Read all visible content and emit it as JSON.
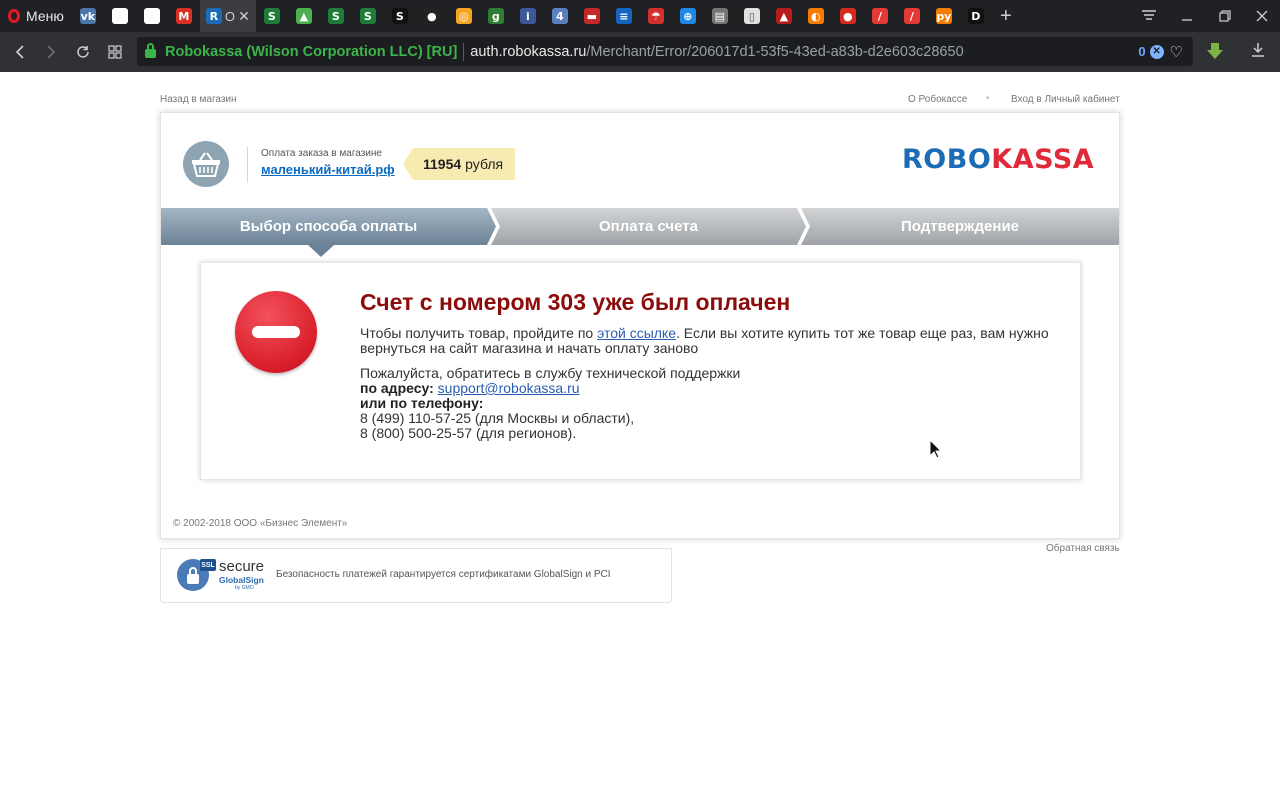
{
  "browser": {
    "menu_label": "Меню",
    "tabs": [
      {
        "icon": "vk-icon",
        "glyph": "vk",
        "bg": "#4a76a8"
      },
      {
        "icon": "blank-page-icon",
        "glyph": "",
        "bg": "#ffffff"
      },
      {
        "icon": "blank-page-icon",
        "glyph": "",
        "bg": "#ffffff"
      },
      {
        "icon": "gmail-icon",
        "glyph": "M",
        "bg": "#d93025"
      },
      {
        "icon": "s-green-icon",
        "glyph": "S",
        "bg": "#1e7b3a"
      },
      {
        "icon": "green-leaf-icon",
        "glyph": "▲",
        "bg": "#4caf50"
      },
      {
        "icon": "s-green-icon",
        "glyph": "S",
        "bg": "#1e7b3a"
      },
      {
        "icon": "s-green-icon",
        "glyph": "S",
        "bg": "#1e7b3a"
      },
      {
        "icon": "s-black-icon",
        "glyph": "S",
        "bg": "#111111"
      },
      {
        "icon": "ball-icon",
        "glyph": "●",
        "bg": "#222222"
      },
      {
        "icon": "circle-icon",
        "glyph": "◎",
        "bg": "#f5a623"
      },
      {
        "icon": "g-icon",
        "glyph": "g",
        "bg": "#2e7d32"
      },
      {
        "icon": "italic-i-icon",
        "glyph": "i",
        "bg": "#3b5998"
      },
      {
        "icon": "number-4-icon",
        "glyph": "4",
        "bg": "#5b7fbf"
      },
      {
        "icon": "car-icon",
        "glyph": "▬",
        "bg": "#c62828"
      },
      {
        "icon": "chip-icon",
        "glyph": "≡",
        "bg": "#1565c0"
      },
      {
        "icon": "umbrella-icon",
        "glyph": "☂",
        "bg": "#d32f2f"
      },
      {
        "icon": "globe-icon",
        "glyph": "⊕",
        "bg": "#1e88e5"
      },
      {
        "icon": "printer-icon",
        "glyph": "▤",
        "bg": "#757575"
      },
      {
        "icon": "file-icon",
        "glyph": "▯",
        "bg": "#e0e0e0"
      },
      {
        "icon": "landscape-icon",
        "glyph": "▲",
        "bg": "#b71c1c"
      },
      {
        "icon": "bike-icon",
        "glyph": "◐",
        "bg": "#f57c00"
      },
      {
        "icon": "russia-flag-icon",
        "glyph": "●",
        "bg": "#d52b1e"
      },
      {
        "icon": "slash-red-icon",
        "glyph": "/",
        "bg": "#e53935"
      },
      {
        "icon": "slash-red-icon",
        "glyph": "/",
        "bg": "#e53935"
      },
      {
        "icon": "ru-icon",
        "glyph": "ру",
        "bg": "#f57c00"
      },
      {
        "icon": "d-icon",
        "glyph": "D",
        "bg": "#111111"
      }
    ],
    "active_tab": {
      "icon": "robokassa-tab-icon",
      "glyph": "R",
      "suffix": "O"
    },
    "cert_label": "Robokassa (Wilson Corporation LLC) [RU]",
    "url_host": "auth.robokassa.ru",
    "url_path": "/Merchant/Error/206017d1-53f5-43ed-a83b-d2e603c28650",
    "url_host_domain": "robokassa.ru",
    "url_host_sub": "auth.",
    "adblock_count": "0"
  },
  "page": {
    "back_link": "Назад в магазин",
    "about_link": "О Робокассе",
    "separator": "•",
    "cabinet_link": "Вход в Личный кабинет",
    "order_caption": "Оплата заказа в магазине",
    "shop_name": "маленький-китай.рф",
    "amount_value": "11954",
    "amount_currency": "рубля",
    "logo_robo": "ROBO",
    "logo_kassa": "KASSA",
    "steps": [
      "Выбор способа оплаты",
      "Оплата счета",
      "Подтверждение"
    ],
    "active_step_index": 0,
    "error": {
      "title": "Счет с номером 303 уже был оплачен",
      "text_before_link": "Чтобы получить товар, пройдите по ",
      "link_text": "этой ссылке",
      "text_after_link": ". Если вы хотите купить тот же товар еще раз, вам нужно вернуться на сайт магазина и начать оплату заново",
      "support_intro": "Пожалуйста, обратитесь в службу технической поддержки",
      "by_address_label": "по адресу:",
      "support_email": "support@robokassa.ru",
      "by_phone_label": "или по телефону:",
      "phone_moscow": "8 (499) 110-57-25 (для Москвы и области),",
      "phone_regions": "8 (800) 500-25-57 (для регионов)."
    },
    "copyright": "© 2002-2018 ООО «Бизнес Элемент»",
    "feedback_link": "Обратная связь",
    "ssl": {
      "badge": "SSL",
      "secure": "secure",
      "globalsign": "GlobalSign",
      "gmo": "by GMO",
      "text": "Безопасность платежей гарантируется сертификатами GlobalSign и PCI"
    }
  }
}
